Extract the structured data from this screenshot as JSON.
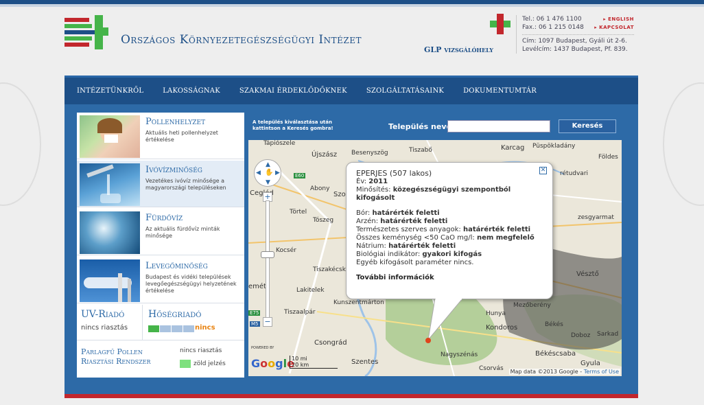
{
  "header": {
    "org_name": "Országos Környezetegészségügyi Intézet",
    "glp": "GLP vizsgálóhely",
    "tel": "Tel.: 06 1 476 1100",
    "fax": "Fax.: 06 1 215 0148",
    "english_link": "▸ ENGLISH",
    "contact_link": "▸ KAPCSOLAT",
    "address": "Cím: 1097 Budapest, Gyáli út 2-6.",
    "postal": "Levélcím: 1437 Budapest, Pf. 839."
  },
  "nav": {
    "items": [
      "Intézetünkről",
      "Lakosságnak",
      "Szakmai érdeklődőknek",
      "Szolgáltatásaink",
      "Dokumentumtár"
    ]
  },
  "panel": {
    "tiles": [
      {
        "title": "Pollenhelyzet",
        "desc": "Aktuális heti pollenhelyzet értékelése"
      },
      {
        "title": "Ivóvízminőség",
        "desc": "Vezetékes ivóvíz minősége a magyarországi településeken"
      },
      {
        "title": "Fürdővíz",
        "desc": "Az aktuális fürdővíz minták minősége"
      },
      {
        "title": "Levegőminőség",
        "desc": "Budapest és vidéki települések levegőegészségügyi helyzetének értékelése"
      }
    ],
    "uv": {
      "title": "UV-Riadó",
      "value": "nincs riasztás"
    },
    "heat": {
      "title": "Hőségriadó",
      "value": "nincs",
      "level": 1,
      "max": 4
    },
    "pollen_alert": {
      "title": "Parlagfű Pollen Riasztási Rendszer",
      "status": "nincs riasztás",
      "indicator": "zöld jelzés"
    }
  },
  "search": {
    "hint": "A település kiválasztása után kattintson a Keresés gombra!",
    "label": "Település neve:",
    "value": "",
    "button": "Keresés"
  },
  "map": {
    "labels": {
      "tapioszele": "Tápiószele",
      "ujszasz": "Újszász",
      "besenyszog": "Besenyszög",
      "tiszabo": "Tiszabő",
      "karcag": "Karcag",
      "puspokladany": "Püspökladány",
      "foldes": "Földes",
      "abony": "Abony",
      "cegled": "Cegléd",
      "szoln": "Szoln",
      "tortel": "Törtel",
      "toszeg": "Tószeg",
      "retudvari": "rétudvari",
      "zesgyarmat": "zesgyarmat",
      "kocser": "Kocsér",
      "tiszakecske": "Tiszakécske",
      "lakitelek": "Lakitelek",
      "emet": "emét",
      "kunszent": "Kunszentmárton",
      "veszto": "Vésztő",
      "mezobereny": "Mezőberény",
      "hunya": "Hunya",
      "tiszaalpar": "Tiszaalpár",
      "bekes": "Békés",
      "kondoros": "Kondoros",
      "doboz": "Doboz",
      "sarkad": "Sarkad",
      "csongrad": "Csongrád",
      "szentes": "Szentes",
      "nagyszenas": "Nagyszénás",
      "bekescsaba": "Békéscsaba",
      "gyula": "Gyula",
      "csorvas": "Csorvás",
      "e60": "E60",
      "e75": "E75",
      "m5": "M5"
    },
    "scale_mi": "10 mi",
    "scale_km": "20 km",
    "attribution": "Map data ©2013 Google",
    "terms": "Terms of Use",
    "google": "Google",
    "powered_by": "POWERED BY"
  },
  "popup": {
    "town": "EPERJES (507 lakos)",
    "year_label": "Év:",
    "year": "2011",
    "rating_label": "Minősítés:",
    "rating": "közegészségügyi szempontból kifogásolt",
    "params": [
      {
        "label": "Bór:",
        "value": "határérték feletti"
      },
      {
        "label": "Arzén:",
        "value": "határérték feletti"
      },
      {
        "label": "Természetes szerves anyagok:",
        "value": "határérték feletti"
      },
      {
        "label": "Összes keménység <50 CaO mg/l:",
        "value": "nem megfelelő"
      },
      {
        "label": "Nátrium:",
        "value": "határérték feletti"
      },
      {
        "label": "Biológiai indikátor:",
        "value": "gyakori kifogás"
      }
    ],
    "other": "Egyéb kifogásolt paraméter nincs.",
    "more": "További információk",
    "close": "✕"
  },
  "colors": {
    "brand_blue": "#1d4f87",
    "accent_red": "#c2272d",
    "alert_orange": "#e88311",
    "ok_green": "#45b449"
  }
}
